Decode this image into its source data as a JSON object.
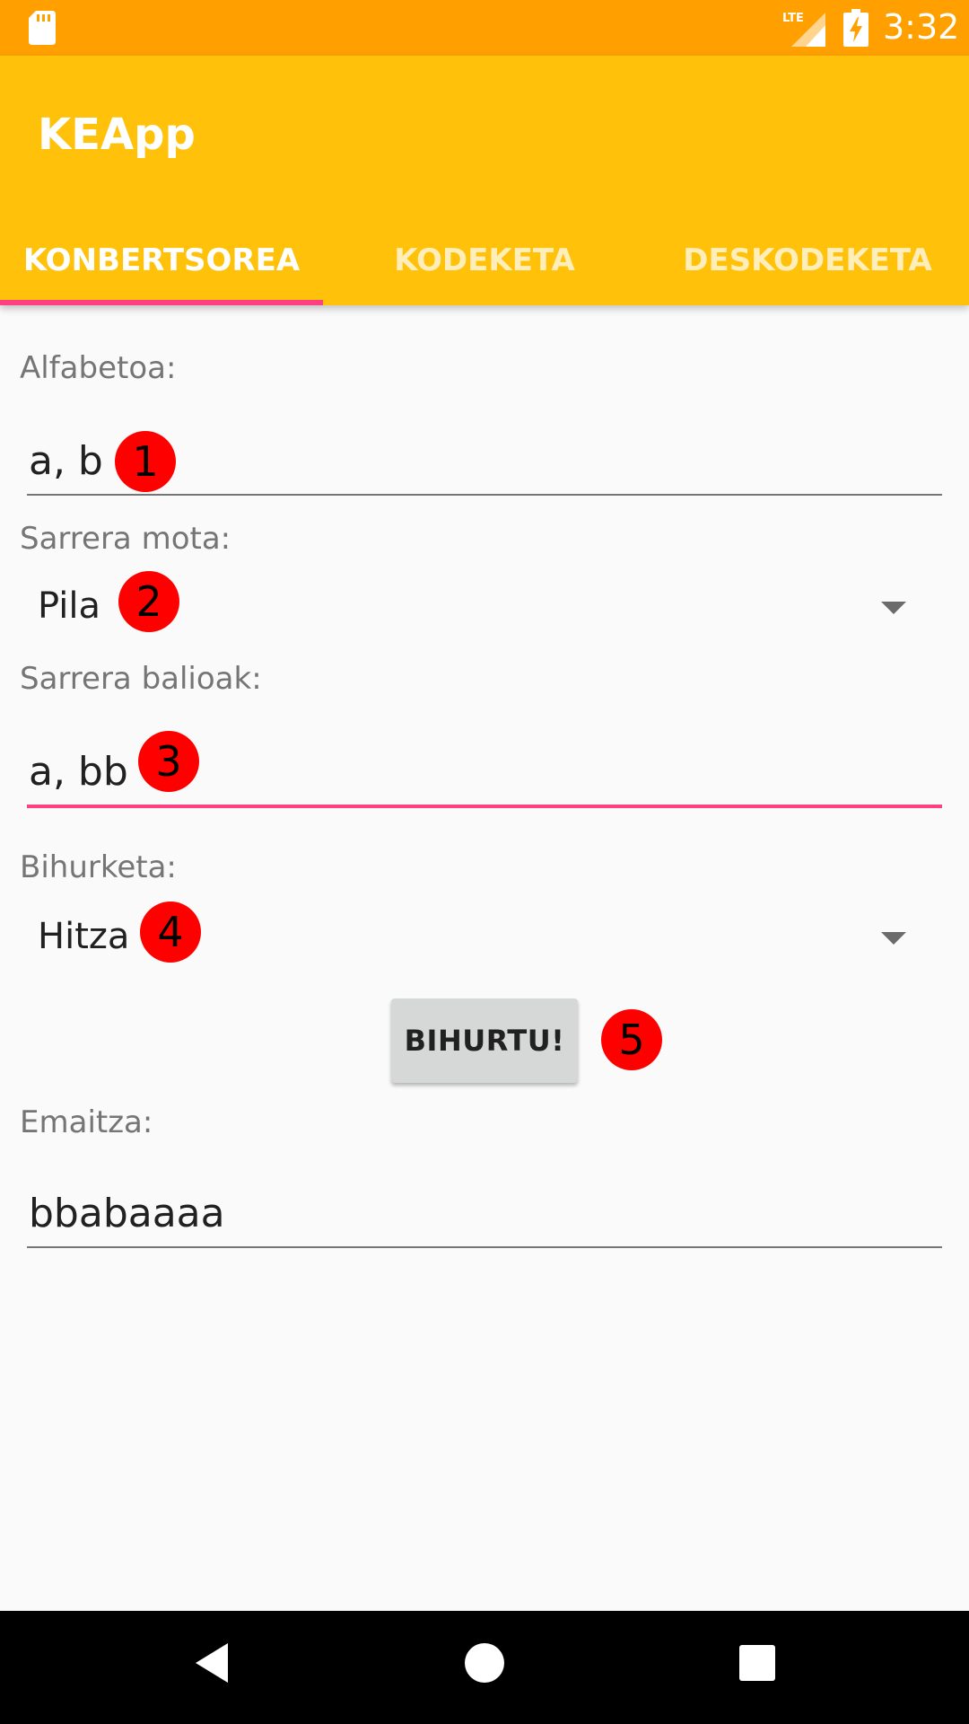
{
  "status_bar": {
    "time": "3:32",
    "network": "LTE",
    "colors": {
      "background": "#ffa000"
    }
  },
  "app_bar": {
    "title": "KEApp",
    "colors": {
      "background": "#ffc10a",
      "accent": "#ff4081"
    }
  },
  "tabs": [
    {
      "label": "KONBERTSOREA",
      "selected": true
    },
    {
      "label": "KODEKETA",
      "selected": false
    },
    {
      "label": "DESKODEKETA",
      "selected": false
    }
  ],
  "form": {
    "alphabet": {
      "label": "Alfabetoa:",
      "value": "a, b",
      "badge": "1"
    },
    "input_type": {
      "label": "Sarrera mota:",
      "selected": "Pila",
      "badge": "2"
    },
    "input_values": {
      "label": "Sarrera balioak:",
      "value": "a, bb",
      "badge": "3"
    },
    "conversion": {
      "label": "Bihurketa:",
      "selected": "Hitza",
      "badge": "4"
    },
    "convert_button": {
      "label": "BIHURTU!",
      "badge": "5"
    },
    "result": {
      "label": "Emaitza:",
      "value": "bbabaaaa"
    }
  },
  "nav_bar": {
    "icons": [
      "back-icon",
      "home-icon",
      "recents-icon"
    ]
  }
}
